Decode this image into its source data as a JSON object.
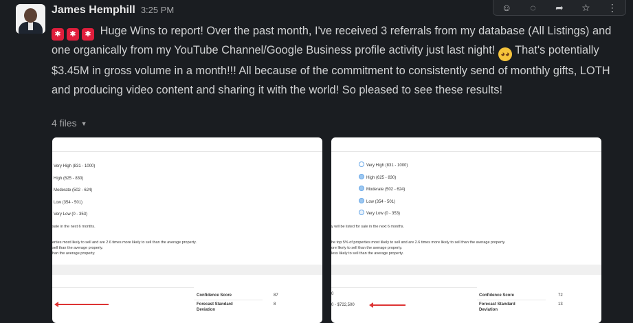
{
  "author": {
    "name": "James Hemphill",
    "time": "3:25 PM"
  },
  "toolbar": {
    "icons": [
      "emoji-reaction-icon",
      "reply-thread-icon",
      "share-icon",
      "bookmark-icon",
      "more-icon"
    ]
  },
  "message": {
    "text_part1": "Huge Wins to report!  Over the past month, I've received 3 referrals from my database (All Listings) and one organically from my YouTube Channel/Google Business profile activity just last night! ",
    "text_part2": "  That's potentially $3.45M in gross volume in a month!!!  All because of the commitment to consistently send of monthly gifts, LOTH and producing video content and sharing it with the world!  So pleased to see these results!"
  },
  "files": {
    "label": "4 files"
  },
  "cards": [
    {
      "legend": [
        "Very High (831 - 1000)",
        "High (625 - 830)",
        "Moderate (502 - 624)",
        "Low (354 - 501)",
        "Very Low (0 - 353)"
      ],
      "line1": "sale in the next 6 months.",
      "line2": "erties most likely to sell and are 2.6 times more likely to sell than the average property.",
      "line3": "sell than the average property.",
      "line4": "han the average property.",
      "left_value": "",
      "confidence_label": "Confidence Score",
      "confidence_value": "87",
      "forecast_label": "Forecast Standard Deviation",
      "forecast_value": "8"
    },
    {
      "legend": [
        "Very High (831 - 1000)",
        "High (625 - 830)",
        "Moderate (502 - 624)",
        "Low (354 - 501)",
        "Very Low (0 - 353)"
      ],
      "line1": "y will be listed for sale in the next 6 months.",
      "line2": "he top 5% of properties most likely to sell and are 2.6 times more likely to sell than the average property.",
      "line3": "ore likely to sell than the average property.",
      "line4": "less likely to sell than the average property.",
      "left_top": "0",
      "left_value": "0 - $722,500",
      "confidence_label": "Confidence Score",
      "confidence_value": "72",
      "forecast_label": "Forecast Standard Deviation",
      "forecast_value": "13"
    }
  ]
}
